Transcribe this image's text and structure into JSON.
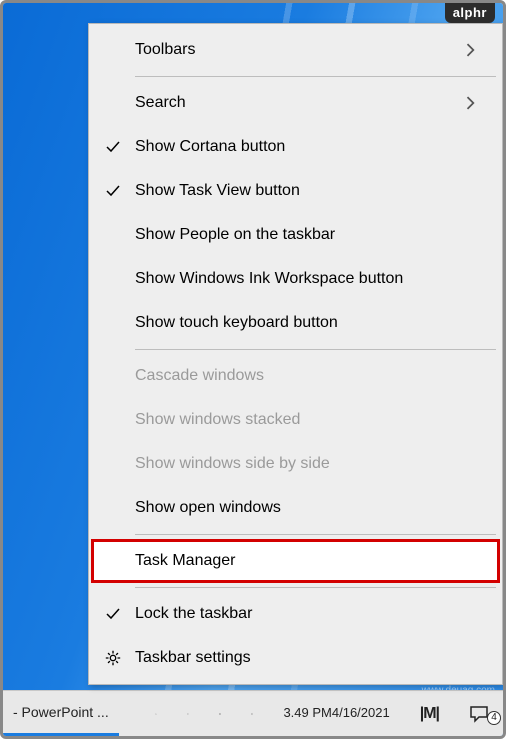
{
  "watermark_top": "alphr",
  "watermark_bottom": "www.deuaq.com",
  "menu": {
    "toolbars": {
      "label": "Toolbars",
      "has_submenu": true
    },
    "search": {
      "label": "Search",
      "has_submenu": true
    },
    "show_cortana": {
      "label": "Show Cortana button",
      "checked": true
    },
    "show_task_view": {
      "label": "Show Task View button",
      "checked": true
    },
    "show_people": {
      "label": "Show People on the taskbar",
      "checked": false
    },
    "show_ink": {
      "label": "Show Windows Ink Workspace button",
      "checked": false
    },
    "show_touch_kb": {
      "label": "Show touch keyboard button",
      "checked": false
    },
    "cascade": {
      "label": "Cascade windows",
      "disabled": true
    },
    "stacked": {
      "label": "Show windows stacked",
      "disabled": true
    },
    "side_by_side": {
      "label": "Show windows side by side",
      "disabled": true
    },
    "show_open": {
      "label": "Show open windows",
      "disabled": false
    },
    "task_manager": {
      "label": "Task Manager",
      "highlighted": true
    },
    "lock_taskbar": {
      "label": "Lock the taskbar",
      "checked": true
    },
    "taskbar_settings": {
      "label": "Taskbar settings",
      "icon": "gear"
    }
  },
  "taskbar": {
    "app_label": "- PowerPoint ...",
    "tray_chevron": "chevron-up",
    "clock_time": "3.49 PM",
    "clock_date": "4/16/2021",
    "logo": "|M|",
    "action_center_count": "4"
  }
}
